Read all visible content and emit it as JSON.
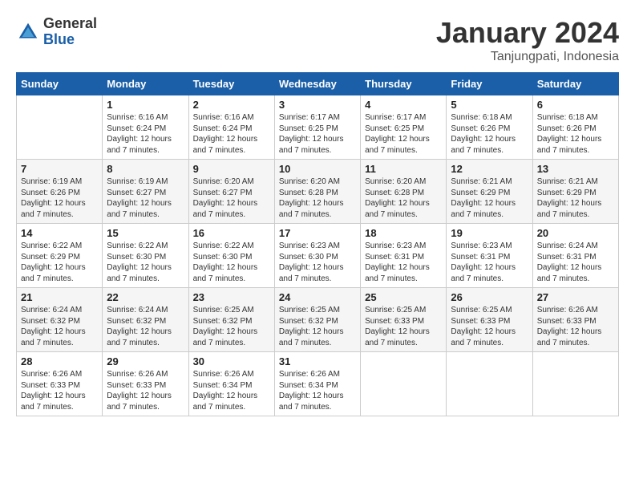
{
  "logo": {
    "general": "General",
    "blue": "Blue"
  },
  "title": "January 2024",
  "location": "Tanjungpati, Indonesia",
  "days": [
    "Sunday",
    "Monday",
    "Tuesday",
    "Wednesday",
    "Thursday",
    "Friday",
    "Saturday"
  ],
  "weeks": [
    [
      {
        "day": "",
        "sunrise": "",
        "sunset": "",
        "daylight": ""
      },
      {
        "day": "1",
        "sunrise": "Sunrise: 6:16 AM",
        "sunset": "Sunset: 6:24 PM",
        "daylight": "Daylight: 12 hours and 7 minutes."
      },
      {
        "day": "2",
        "sunrise": "Sunrise: 6:16 AM",
        "sunset": "Sunset: 6:24 PM",
        "daylight": "Daylight: 12 hours and 7 minutes."
      },
      {
        "day": "3",
        "sunrise": "Sunrise: 6:17 AM",
        "sunset": "Sunset: 6:25 PM",
        "daylight": "Daylight: 12 hours and 7 minutes."
      },
      {
        "day": "4",
        "sunrise": "Sunrise: 6:17 AM",
        "sunset": "Sunset: 6:25 PM",
        "daylight": "Daylight: 12 hours and 7 minutes."
      },
      {
        "day": "5",
        "sunrise": "Sunrise: 6:18 AM",
        "sunset": "Sunset: 6:26 PM",
        "daylight": "Daylight: 12 hours and 7 minutes."
      },
      {
        "day": "6",
        "sunrise": "Sunrise: 6:18 AM",
        "sunset": "Sunset: 6:26 PM",
        "daylight": "Daylight: 12 hours and 7 minutes."
      }
    ],
    [
      {
        "day": "7",
        "sunrise": "Sunrise: 6:19 AM",
        "sunset": "Sunset: 6:26 PM",
        "daylight": "Daylight: 12 hours and 7 minutes."
      },
      {
        "day": "8",
        "sunrise": "Sunrise: 6:19 AM",
        "sunset": "Sunset: 6:27 PM",
        "daylight": "Daylight: 12 hours and 7 minutes."
      },
      {
        "day": "9",
        "sunrise": "Sunrise: 6:20 AM",
        "sunset": "Sunset: 6:27 PM",
        "daylight": "Daylight: 12 hours and 7 minutes."
      },
      {
        "day": "10",
        "sunrise": "Sunrise: 6:20 AM",
        "sunset": "Sunset: 6:28 PM",
        "daylight": "Daylight: 12 hours and 7 minutes."
      },
      {
        "day": "11",
        "sunrise": "Sunrise: 6:20 AM",
        "sunset": "Sunset: 6:28 PM",
        "daylight": "Daylight: 12 hours and 7 minutes."
      },
      {
        "day": "12",
        "sunrise": "Sunrise: 6:21 AM",
        "sunset": "Sunset: 6:29 PM",
        "daylight": "Daylight: 12 hours and 7 minutes."
      },
      {
        "day": "13",
        "sunrise": "Sunrise: 6:21 AM",
        "sunset": "Sunset: 6:29 PM",
        "daylight": "Daylight: 12 hours and 7 minutes."
      }
    ],
    [
      {
        "day": "14",
        "sunrise": "Sunrise: 6:22 AM",
        "sunset": "Sunset: 6:29 PM",
        "daylight": "Daylight: 12 hours and 7 minutes."
      },
      {
        "day": "15",
        "sunrise": "Sunrise: 6:22 AM",
        "sunset": "Sunset: 6:30 PM",
        "daylight": "Daylight: 12 hours and 7 minutes."
      },
      {
        "day": "16",
        "sunrise": "Sunrise: 6:22 AM",
        "sunset": "Sunset: 6:30 PM",
        "daylight": "Daylight: 12 hours and 7 minutes."
      },
      {
        "day": "17",
        "sunrise": "Sunrise: 6:23 AM",
        "sunset": "Sunset: 6:30 PM",
        "daylight": "Daylight: 12 hours and 7 minutes."
      },
      {
        "day": "18",
        "sunrise": "Sunrise: 6:23 AM",
        "sunset": "Sunset: 6:31 PM",
        "daylight": "Daylight: 12 hours and 7 minutes."
      },
      {
        "day": "19",
        "sunrise": "Sunrise: 6:23 AM",
        "sunset": "Sunset: 6:31 PM",
        "daylight": "Daylight: 12 hours and 7 minutes."
      },
      {
        "day": "20",
        "sunrise": "Sunrise: 6:24 AM",
        "sunset": "Sunset: 6:31 PM",
        "daylight": "Daylight: 12 hours and 7 minutes."
      }
    ],
    [
      {
        "day": "21",
        "sunrise": "Sunrise: 6:24 AM",
        "sunset": "Sunset: 6:32 PM",
        "daylight": "Daylight: 12 hours and 7 minutes."
      },
      {
        "day": "22",
        "sunrise": "Sunrise: 6:24 AM",
        "sunset": "Sunset: 6:32 PM",
        "daylight": "Daylight: 12 hours and 7 minutes."
      },
      {
        "day": "23",
        "sunrise": "Sunrise: 6:25 AM",
        "sunset": "Sunset: 6:32 PM",
        "daylight": "Daylight: 12 hours and 7 minutes."
      },
      {
        "day": "24",
        "sunrise": "Sunrise: 6:25 AM",
        "sunset": "Sunset: 6:32 PM",
        "daylight": "Daylight: 12 hours and 7 minutes."
      },
      {
        "day": "25",
        "sunrise": "Sunrise: 6:25 AM",
        "sunset": "Sunset: 6:33 PM",
        "daylight": "Daylight: 12 hours and 7 minutes."
      },
      {
        "day": "26",
        "sunrise": "Sunrise: 6:25 AM",
        "sunset": "Sunset: 6:33 PM",
        "daylight": "Daylight: 12 hours and 7 minutes."
      },
      {
        "day": "27",
        "sunrise": "Sunrise: 6:26 AM",
        "sunset": "Sunset: 6:33 PM",
        "daylight": "Daylight: 12 hours and 7 minutes."
      }
    ],
    [
      {
        "day": "28",
        "sunrise": "Sunrise: 6:26 AM",
        "sunset": "Sunset: 6:33 PM",
        "daylight": "Daylight: 12 hours and 7 minutes."
      },
      {
        "day": "29",
        "sunrise": "Sunrise: 6:26 AM",
        "sunset": "Sunset: 6:33 PM",
        "daylight": "Daylight: 12 hours and 7 minutes."
      },
      {
        "day": "30",
        "sunrise": "Sunrise: 6:26 AM",
        "sunset": "Sunset: 6:34 PM",
        "daylight": "Daylight: 12 hours and 7 minutes."
      },
      {
        "day": "31",
        "sunrise": "Sunrise: 6:26 AM",
        "sunset": "Sunset: 6:34 PM",
        "daylight": "Daylight: 12 hours and 7 minutes."
      },
      {
        "day": "",
        "sunrise": "",
        "sunset": "",
        "daylight": ""
      },
      {
        "day": "",
        "sunrise": "",
        "sunset": "",
        "daylight": ""
      },
      {
        "day": "",
        "sunrise": "",
        "sunset": "",
        "daylight": ""
      }
    ]
  ]
}
